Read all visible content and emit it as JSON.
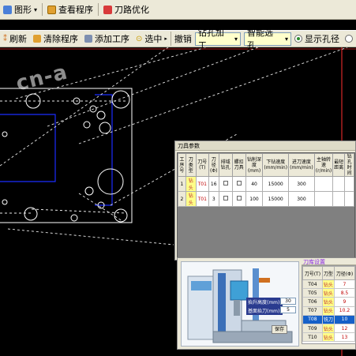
{
  "menubar": {
    "graphics_label": "图形",
    "view_program_label": "查看程序",
    "path_optimize_label": "刀路优化"
  },
  "toolbar": {
    "refresh_label": "刷新",
    "clear_program_label": "清除程序",
    "add_process_label": "添加工序",
    "select_label": "选中",
    "undo_label": "撤销",
    "process_type_value": "钻孔加工",
    "smart_select_value": "智能选孔",
    "show_hole_dia_label": "显示孔径"
  },
  "watermark": "cn-a",
  "param_dialog": {
    "title": "刀具参数",
    "headers": [
      "工序号",
      "刀类型",
      "刀号(T)",
      "刀径(Φ)",
      "排域钻孔",
      "螺扣刀具",
      "钻削深度(mm)",
      "下钻速度(mm/min)",
      "进刀速度(mm/min)",
      "主轴转速(r/min)",
      "最短距离",
      "钻孔时间"
    ],
    "rows": [
      {
        "no": "1",
        "type": "钻头",
        "tool": "T01",
        "dia": "16",
        "depth": "40",
        "feed_down": "15000",
        "feed": "300"
      },
      {
        "no": "2",
        "type": "钻头",
        "tool": "T01",
        "dia": "3",
        "depth": "100",
        "feed_down": "15000",
        "feed": "300"
      }
    ]
  },
  "library": {
    "title": "刀库设置",
    "headers": [
      "刀号(T)",
      "刀型",
      "刀径(Φ)"
    ],
    "rows": [
      {
        "no": "T04",
        "type": "钻头",
        "dia": "7"
      },
      {
        "no": "T05",
        "type": "钻头",
        "dia": "8.5"
      },
      {
        "no": "T06",
        "type": "钻头",
        "dia": "9"
      },
      {
        "no": "T07",
        "type": "钻头",
        "dia": "10.2"
      },
      {
        "no": "T08",
        "type": "铣刀",
        "dia": "10"
      },
      {
        "no": "T09",
        "type": "钻头",
        "dia": "12"
      },
      {
        "no": "T10",
        "type": "钻头",
        "dia": "13"
      }
    ],
    "selected_row": "T08"
  },
  "machine": {
    "lift_label": "抬升高度(mm):",
    "lift_value": "30",
    "ref_label": "基面抬刀(mm):",
    "ref_value": "5",
    "save_label": "保存"
  },
  "colors": {
    "canvas_bg": "#000000",
    "part_outline": "#ffffff",
    "region_blue": "#1a2cff",
    "path_line": "#e8e8e8",
    "boundary_red": "#ff3030",
    "selected_row": "#1560c8"
  }
}
